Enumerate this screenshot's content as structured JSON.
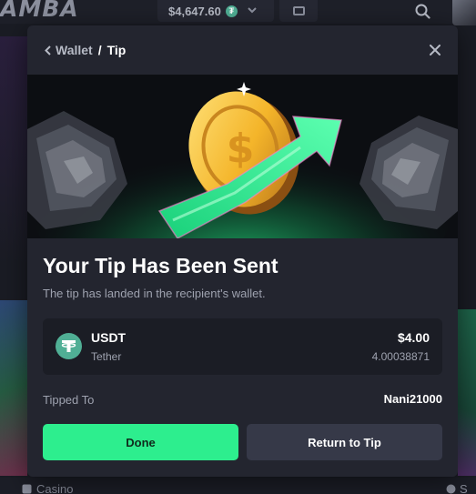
{
  "background": {
    "logo": "AMBA",
    "balance": "$4,647.60",
    "balance_currency_icon": "tether-icon",
    "bottom_nav": {
      "casino": "Casino",
      "right_partial": "S"
    }
  },
  "modal": {
    "breadcrumb": {
      "back": "Wallet",
      "separator": "/",
      "current": "Tip"
    },
    "title": "Your Tip Has Been Sent",
    "subtitle": "The tip has landed in the recipient's wallet.",
    "asset": {
      "symbol": "USDT",
      "name": "Tether",
      "usd_value": "$4.00",
      "amount": "4.00038871",
      "icon": "tether-icon",
      "icon_color": "#50af95"
    },
    "tipped_to": {
      "label": "Tipped To",
      "value": "Nani21000"
    },
    "buttons": {
      "done": "Done",
      "return": "Return to Tip"
    }
  },
  "colors": {
    "accent_green": "#2dee8e",
    "modal_bg": "#23252f",
    "card_bg": "#1b1d25",
    "secondary_button": "#363948"
  }
}
